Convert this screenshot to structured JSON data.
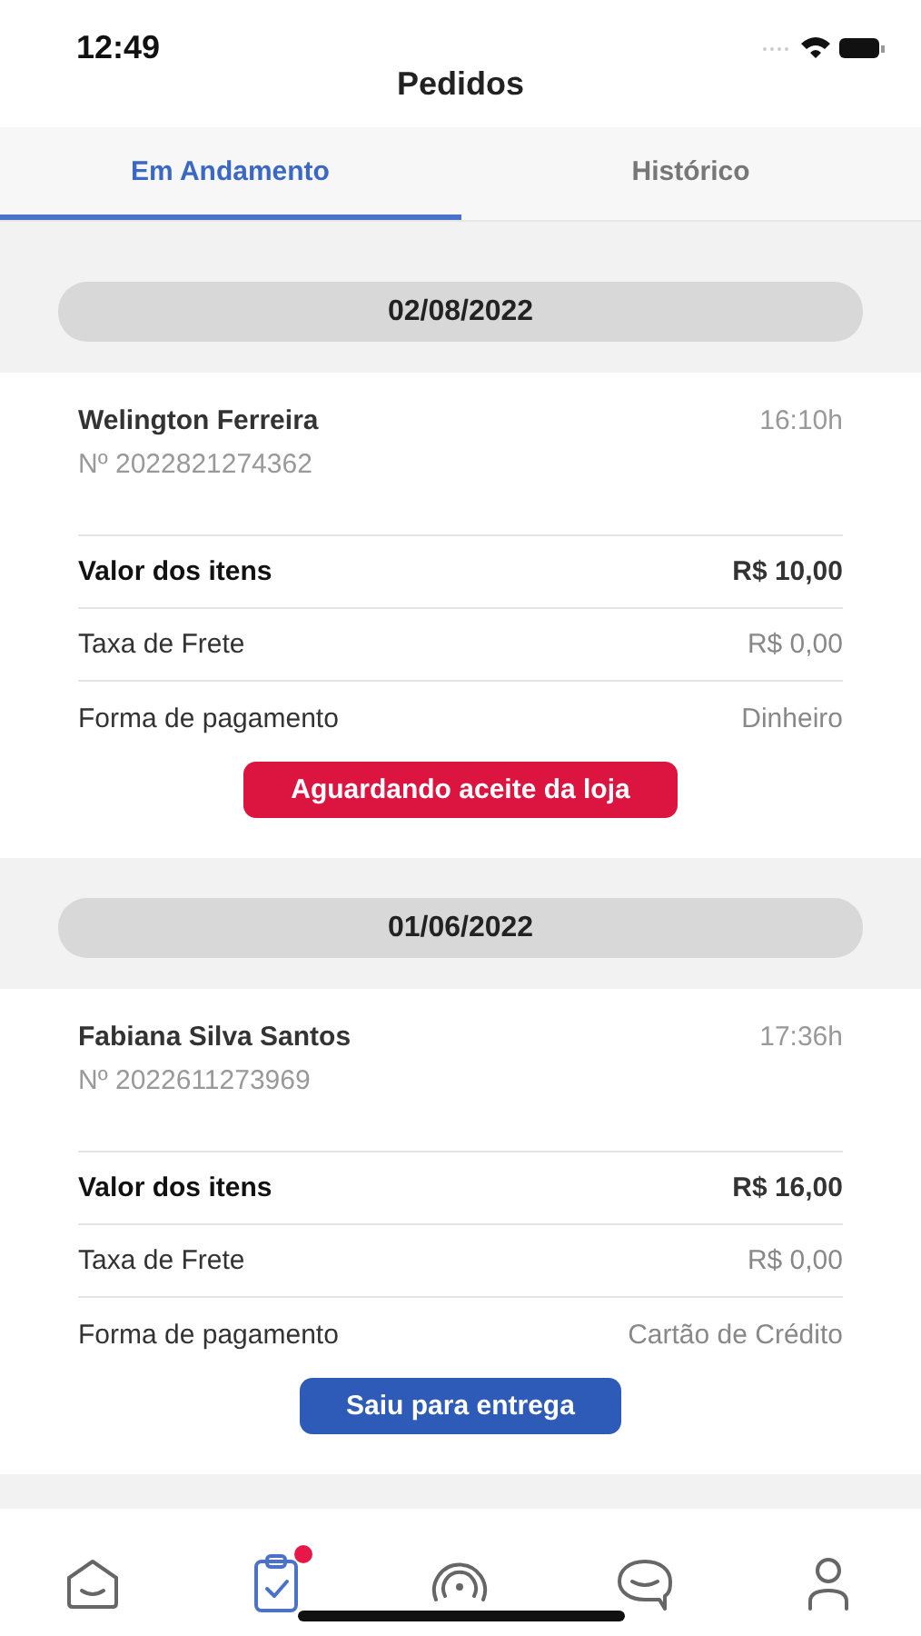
{
  "status_bar": {
    "time": "12:49"
  },
  "title": "Pedidos",
  "tabs": [
    {
      "label": "Em Andamento",
      "selected": true
    },
    {
      "label": "Histórico",
      "selected": false
    }
  ],
  "orders": [
    {
      "date": "02/08/2022",
      "customer": "Welington Ferreira",
      "number": "Nº 2022821274362",
      "time": "16:10h",
      "rows": [
        {
          "kind": "total",
          "label": "Valor dos itens",
          "value": "R$ 10,00"
        },
        {
          "kind": "line",
          "label": "Taxa de Frete",
          "value": "R$ 0,00"
        },
        {
          "kind": "line",
          "label": "Forma de pagamento",
          "value": "Dinheiro"
        }
      ],
      "status": {
        "label": "Aguardando aceite da loja",
        "color": "#dc1440"
      }
    },
    {
      "date": "01/06/2022",
      "customer": "Fabiana Silva Santos",
      "number": "Nº 2022611273969",
      "time": "17:36h",
      "rows": [
        {
          "kind": "total",
          "label": "Valor dos itens",
          "value": "R$ 16,00"
        },
        {
          "kind": "line",
          "label": "Taxa de Frete",
          "value": "R$ 0,00"
        },
        {
          "kind": "line",
          "label": "Forma de pagamento",
          "value": "Cartão de Crédito"
        }
      ],
      "status": {
        "label": "Saiu para entrega",
        "color": "#2f5bb8"
      }
    }
  ],
  "nav": [
    {
      "kind": "home",
      "selected": false,
      "badge": false
    },
    {
      "kind": "orders",
      "selected": true,
      "badge": true
    },
    {
      "kind": "signal",
      "selected": false,
      "badge": false
    },
    {
      "kind": "chat",
      "selected": false,
      "badge": false
    },
    {
      "kind": "profile",
      "selected": false,
      "badge": false
    }
  ]
}
